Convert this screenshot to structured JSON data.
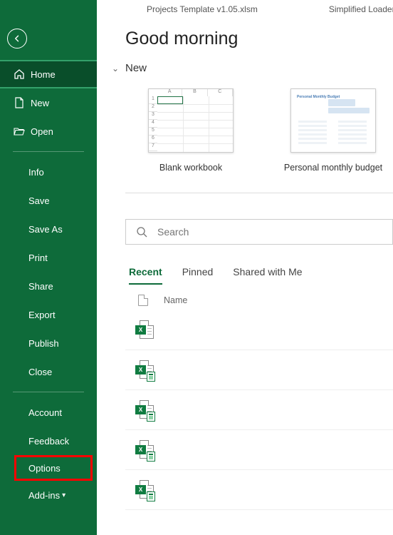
{
  "titlebar": {
    "file1": "Projects Template v1.05.xlsm",
    "file2": "Simplified Loader"
  },
  "sidebar": {
    "home": "Home",
    "new": "New",
    "open": "Open",
    "info": "Info",
    "save": "Save",
    "saveas": "Save As",
    "print": "Print",
    "share": "Share",
    "export": "Export",
    "publish": "Publish",
    "close": "Close",
    "account": "Account",
    "feedback": "Feedback",
    "options": "Options",
    "addins": "Add-ins"
  },
  "greeting": "Good morning",
  "section_new": "New",
  "templates": {
    "blank": "Blank workbook",
    "budget": "Personal monthly budget",
    "budget_thumb_title": "Personal Monthly Budget"
  },
  "search": {
    "placeholder": "Search"
  },
  "tabs": {
    "recent": "Recent",
    "pinned": "Pinned",
    "shared": "Shared with Me"
  },
  "list": {
    "header_name": "Name",
    "icon_letter": "X",
    "rows": [
      {},
      {},
      {},
      {},
      {}
    ]
  },
  "colors": {
    "brand": "#0e6b3a",
    "highlight": "#ff0000"
  }
}
